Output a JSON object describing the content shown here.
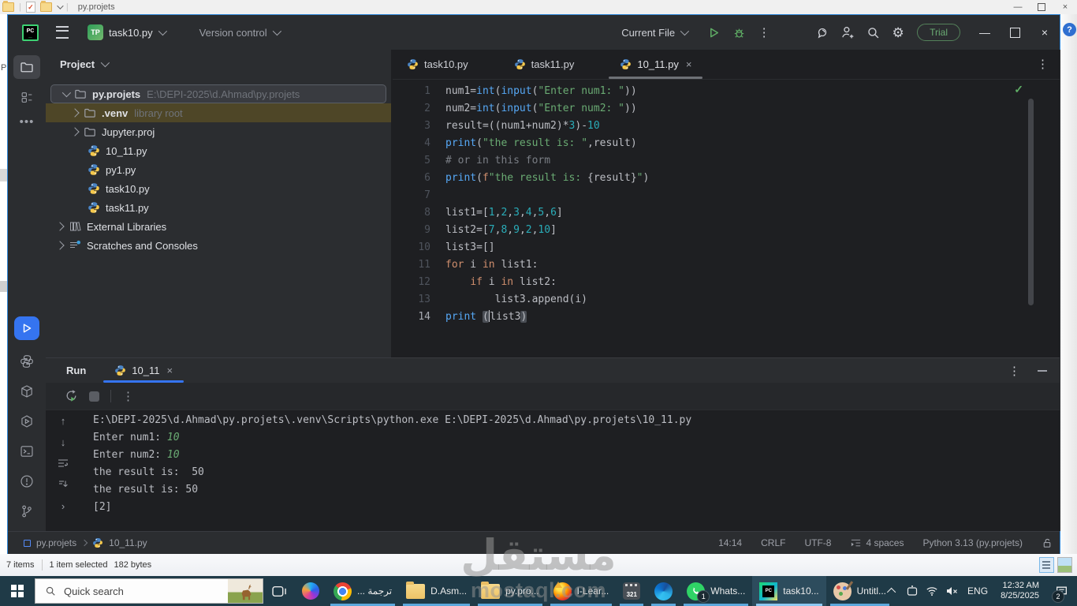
{
  "icons": {
    "kebab": "⋮",
    "gear": "⚙",
    "check": "✓",
    "close": "×",
    "minimize": "–",
    "arrow_up": "↑",
    "arrow_down": "↓",
    "chevron_right": "›",
    "at": "@",
    "rerun": "↻",
    "help": "?"
  },
  "explorer": {
    "title": "py.projets",
    "nav_clip": "Pi",
    "help": "?",
    "status": {
      "items_count": "7 items",
      "selected": "1 item selected",
      "size": "182 bytes"
    }
  },
  "titlebar": {
    "logo": "PC",
    "project_badge": "TP",
    "project_name": "task10.py",
    "vcs": "Version control",
    "run_config": "Current File",
    "trial": "Trial"
  },
  "editor": {
    "tabs": [
      {
        "label": "task10.py",
        "active": false,
        "close": false
      },
      {
        "label": "task11.py",
        "active": false,
        "close": false
      },
      {
        "label": "10_11.py",
        "active": true,
        "close": true
      }
    ],
    "current_line": 14,
    "code_lines": [
      [
        [
          "d",
          "num1="
        ],
        [
          "f",
          "int"
        ],
        [
          "d",
          "("
        ],
        [
          "f",
          "input"
        ],
        [
          "d",
          "("
        ],
        [
          "s",
          "\"Enter num1: \""
        ],
        [
          "d",
          "))"
        ]
      ],
      [
        [
          "d",
          "num2="
        ],
        [
          "f",
          "int"
        ],
        [
          "d",
          "("
        ],
        [
          "f",
          "input"
        ],
        [
          "d",
          "("
        ],
        [
          "s",
          "\"Enter num2: \""
        ],
        [
          "d",
          "))"
        ]
      ],
      [
        [
          "d",
          "result=((num1+num2)*"
        ],
        [
          "n",
          "3"
        ],
        [
          "d",
          ")-"
        ],
        [
          "n",
          "10"
        ]
      ],
      [
        [
          "f",
          "print"
        ],
        [
          "d",
          "("
        ],
        [
          "s",
          "\"the result is: \""
        ],
        [
          "d",
          ",result)"
        ]
      ],
      [
        [
          "c",
          "# or in this form"
        ]
      ],
      [
        [
          "f",
          "print"
        ],
        [
          "d",
          "("
        ],
        [
          "k",
          "f"
        ],
        [
          "s",
          "\"the result is: "
        ],
        [
          "d",
          "{result}"
        ],
        [
          "s",
          "\""
        ],
        [
          "d",
          ")"
        ]
      ],
      [],
      [
        [
          "d",
          "list1=["
        ],
        [
          "n",
          "1"
        ],
        [
          "d",
          ","
        ],
        [
          "n",
          "2"
        ],
        [
          "d",
          ","
        ],
        [
          "n",
          "3"
        ],
        [
          "d",
          ","
        ],
        [
          "n",
          "4"
        ],
        [
          "d",
          ","
        ],
        [
          "n",
          "5"
        ],
        [
          "d",
          ","
        ],
        [
          "n",
          "6"
        ],
        [
          "d",
          "]"
        ]
      ],
      [
        [
          "d",
          "list2=["
        ],
        [
          "n",
          "7"
        ],
        [
          "d",
          ","
        ],
        [
          "n",
          "8"
        ],
        [
          "d",
          ","
        ],
        [
          "n",
          "9"
        ],
        [
          "d",
          ","
        ],
        [
          "n",
          "2"
        ],
        [
          "d",
          ","
        ],
        [
          "n",
          "10"
        ],
        [
          "d",
          "]"
        ]
      ],
      [
        [
          "d",
          "list3=[]"
        ]
      ],
      [
        [
          "k",
          "for"
        ],
        [
          "d",
          " i "
        ],
        [
          "k",
          "in"
        ],
        [
          "d",
          " list1:"
        ]
      ],
      [
        [
          "d",
          "    "
        ],
        [
          "k",
          "if"
        ],
        [
          "d",
          " i "
        ],
        [
          "k",
          "in"
        ],
        [
          "d",
          " list2:"
        ]
      ],
      [
        [
          "d",
          "        list3.append(i)"
        ]
      ],
      [
        [
          "f",
          "print"
        ],
        [
          "d",
          " "
        ],
        [
          "h",
          "("
        ],
        [
          "caret",
          ""
        ],
        [
          "d",
          "list3"
        ],
        [
          "h",
          ")"
        ]
      ]
    ]
  },
  "project_panel": {
    "header": "Project",
    "tree": [
      {
        "label": "py.projets",
        "hint": "E:\\DEPI-2025\\d.Ahmad\\py.projets",
        "icon": "folder",
        "chevron": "down",
        "indent": 0,
        "bold": true,
        "state": "selected"
      },
      {
        "label": ".venv",
        "hint": "library root",
        "icon": "folder",
        "chevron": "right",
        "indent": 1,
        "bold": true,
        "state": "venv"
      },
      {
        "label": "Jupyter.proj",
        "icon": "folder",
        "chevron": "right",
        "indent": 1
      },
      {
        "label": "10_11.py",
        "icon": "py",
        "indent": 1
      },
      {
        "label": "py1.py",
        "icon": "py",
        "indent": 1
      },
      {
        "label": "task10.py",
        "icon": "py",
        "indent": 1
      },
      {
        "label": "task11.py",
        "icon": "py",
        "indent": 1
      },
      {
        "label": "External Libraries",
        "icon": "lib",
        "chevron": "right",
        "indent": 0
      },
      {
        "label": "Scratches and Consoles",
        "icon": "scratch",
        "chevron": "right",
        "indent": 0
      }
    ]
  },
  "run_panel": {
    "title": "Run",
    "tab": "10_11",
    "console": [
      [
        [
          "t",
          "E:\\DEPI-2025\\d.Ahmad\\py.projets\\.venv\\Scripts\\python.exe E:\\DEPI-2025\\d.Ahmad\\py.projets\\10_11.py"
        ]
      ],
      [
        [
          "t",
          "Enter num1: "
        ],
        [
          "in",
          "10"
        ]
      ],
      [
        [
          "t",
          "Enter num2: "
        ],
        [
          "in",
          "10"
        ]
      ],
      [
        [
          "t",
          "the result is:  50"
        ]
      ],
      [
        [
          "t",
          "the result is: 50"
        ]
      ],
      [
        [
          "t",
          "[2]"
        ]
      ]
    ]
  },
  "status_bar": {
    "crumb_project": "py.projets",
    "crumb_file": "10_11.py",
    "right": [
      {
        "label": "14:14"
      },
      {
        "label": "CRLF"
      },
      {
        "label": "UTF-8"
      },
      {
        "label": "4 spaces",
        "icon": "indent"
      },
      {
        "label": "Python 3.13 (py.projets)"
      },
      {
        "label": "",
        "icon": "unlock"
      }
    ]
  },
  "taskbar": {
    "search_placeholder": "Quick search",
    "mpc_text": "321",
    "pyc_logo": "PC",
    "apps": [
      {
        "icon": "chrome",
        "label": "... ترجمة"
      },
      {
        "icon": "folder",
        "label": "D.Asm..."
      },
      {
        "icon": "folder",
        "label": "py.pro..."
      },
      {
        "icon": "firefox",
        "label": "I-Lear..."
      },
      {
        "icon": "mpc",
        "label": ""
      },
      {
        "icon": "edge",
        "label": ""
      },
      {
        "icon": "whatsapp",
        "label": "Whats...",
        "badge": "1"
      },
      {
        "icon": "pycharm",
        "label": "task10...",
        "active": true
      },
      {
        "icon": "paint",
        "label": "Untitl..."
      }
    ],
    "tray": {
      "lang": "ENG",
      "time": "12:32 AM",
      "date": "8/25/2025",
      "notif_badge": "2"
    }
  },
  "watermark": {
    "arabic": "مستقل",
    "latin": "mostaql.com"
  }
}
